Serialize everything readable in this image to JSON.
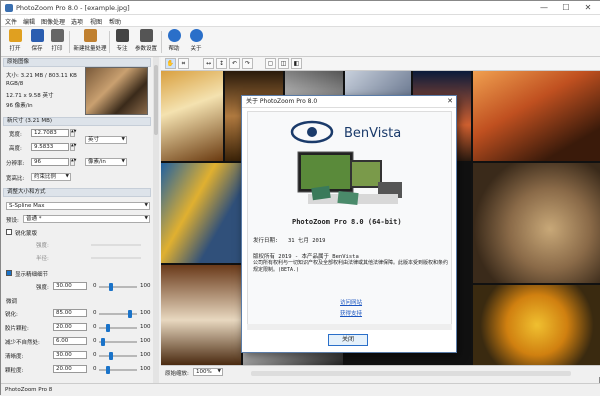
{
  "window": {
    "title": "PhotoZoom Pro 8.0 - [example.jpg]",
    "min": "—",
    "max": "☐",
    "close": "✕"
  },
  "menu": [
    "文件",
    "编辑",
    "图像处理",
    "选项",
    "视图",
    "帮助"
  ],
  "toolbar": [
    {
      "label": "打开",
      "icon": "folder-open-icon",
      "color": "#e0a020"
    },
    {
      "label": "保存",
      "icon": "save-icon",
      "color": "#2a5db0"
    },
    {
      "label": "打印",
      "icon": "printer-icon",
      "color": "#666666"
    },
    {
      "label": "新建批量处理",
      "icon": "batch-icon",
      "color": "#c08030"
    },
    {
      "label": "专注",
      "icon": "preview-icon",
      "color": "#444444"
    },
    {
      "label": "参数设置",
      "icon": "settings-icon",
      "color": "#555555"
    },
    {
      "label": "帮助",
      "icon": "help-icon",
      "color": "#2a6fc9"
    },
    {
      "label": "关于",
      "icon": "info-icon",
      "color": "#2a6fc9"
    }
  ],
  "source": {
    "header": "原始图像",
    "size": "大小: 3.21 MB / 803.11 KB",
    "color_mode": "RGB/8",
    "dims": "12.71 x 9.58 英寸",
    "resolution": "96 像素/in"
  },
  "new_size": {
    "header": "新尺寸 (3.21 MB)",
    "width_label": "宽度:",
    "width_value": "12.7083",
    "height_label": "高度:",
    "height_value": "9.5833",
    "unit": "英寸",
    "resolution_label": "分辨率:",
    "resolution_value": "96",
    "resolution_unit": "像素/in",
    "aspect_label": "宽高比:",
    "aspect_value": "约束比例"
  },
  "resize": {
    "header": "调整大小和方式",
    "method": "S-Spline Max",
    "preset_label": "预设:",
    "preset_value": "普通 *",
    "sharpen_header": "锐化蒙版",
    "amount_label": "强度:",
    "radius_label": "半径:",
    "fine_header": "显示精细细节",
    "fine_label": "强度:",
    "fine_value": "30.00",
    "fine_min": "0",
    "fine_max": "100",
    "fine_level": 0.3,
    "fine_tuning_header": "微调",
    "params": [
      {
        "label": "锐化:",
        "value": "85.00",
        "min": "0",
        "max": "100",
        "level": 0.85
      },
      {
        "label": "胶片颗粒:",
        "value": "20.00",
        "min": "0",
        "max": "100",
        "level": 0.2
      },
      {
        "label": "减少不自然处:",
        "value": "6.00",
        "min": "0",
        "max": "100",
        "level": 0.06
      },
      {
        "label": "清晰度:",
        "value": "30.00",
        "min": "0",
        "max": "100",
        "level": 0.3
      },
      {
        "label": "颗粒度:",
        "value": "20.00",
        "min": "0",
        "max": "100",
        "level": 0.2
      }
    ]
  },
  "view_status": {
    "label": "原始缩放:",
    "zoom": "100%"
  },
  "status": "PhotoZoom Pro 8",
  "dialog": {
    "title": "关于 PhotoZoom Pro 8.0",
    "close": "✕",
    "logo": "BenVista",
    "product": "PhotoZoom Pro 8.0 (64-bit)",
    "release_label": "发行日期:",
    "release_date": "31 七月 2019",
    "copyright": "版权所有 2019 - 本产品属于 BenVista",
    "legal": "公司所有权利与一切知识产权及全部权利由法律或其他法律保障。此版本受到版权和条约规定限制。(BETA.)",
    "link1": "访问网站",
    "link2": "获得支持",
    "ok": "关闭"
  },
  "colors": {
    "accent": "#1a73c9",
    "panel_bg": "#f0f0f0",
    "dialog_border": "#5a7ca8"
  }
}
